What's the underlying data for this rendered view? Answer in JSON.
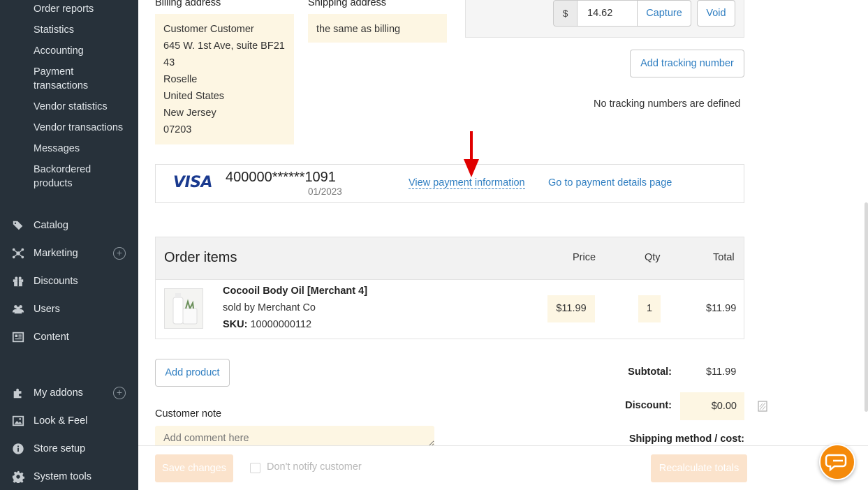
{
  "sidebar": {
    "sub_items": [
      "Order reports",
      "Statistics",
      "Accounting",
      "Payment",
      "transactions",
      "Vendor statistics",
      "Vendor transactions",
      "Messages",
      "Backordered",
      "products"
    ],
    "main_items": [
      {
        "label": "Catalog",
        "icon": "tags-icon"
      },
      {
        "label": "Marketing",
        "icon": "marketing-icon"
      },
      {
        "label": "Discounts",
        "icon": "gift-icon"
      },
      {
        "label": "Users",
        "icon": "users-icon"
      },
      {
        "label": "Content",
        "icon": "content-icon"
      },
      {
        "label": "My addons",
        "icon": "puzzle-icon"
      },
      {
        "label": "Look & Feel",
        "icon": "image-icon"
      },
      {
        "label": "Store setup",
        "icon": "info-icon"
      },
      {
        "label": "System tools",
        "icon": "gear-icon"
      }
    ],
    "plus_symbol": "+"
  },
  "billing": {
    "title": "Billing address",
    "lines": [
      "Customer Customer",
      "645 W. 1st Ave, suite BF21",
      "43",
      "Roselle",
      "United States",
      "New Jersey",
      "07203"
    ]
  },
  "shipping": {
    "title": "Shipping address",
    "value": "the same as billing"
  },
  "capture": {
    "currency": "$",
    "amount": "14.62",
    "capture_label": "Capture",
    "void_label": "Void"
  },
  "tracking": {
    "add_label": "Add tracking number",
    "empty_text": "No tracking numbers are defined"
  },
  "payment": {
    "brand": "VISA",
    "card_number": "400000******1091",
    "expiry": "01/2023",
    "view_info_label": "View payment information",
    "details_label": "Go to payment details page"
  },
  "order_items": {
    "title": "Order items",
    "col_price": "Price",
    "col_qty": "Qty",
    "col_total": "Total",
    "items": [
      {
        "name": "Cocooil Body Oil [Merchant 4]",
        "vendor": "sold by Merchant Co",
        "sku_label": "SKU:",
        "sku": "10000000112",
        "price": "$11.99",
        "qty": "1",
        "total": "$11.99"
      }
    ]
  },
  "add_product_label": "Add product",
  "totals": {
    "subtotal_label": "Subtotal:",
    "subtotal_value": "$11.99",
    "discount_label": "Discount:",
    "discount_value": "$0.00",
    "shipping_label": "Shipping method / cost:"
  },
  "note": {
    "label": "Customer note",
    "placeholder": "Add comment here"
  },
  "bottom_bar": {
    "save_label": "Save changes",
    "dont_notify_label": "Don't notify customer",
    "recalc_label": "Recalculate totals"
  },
  "colors": {
    "sidebar_bg": "#27313a",
    "link": "#2f7ec1",
    "highlight_bg": "#fdf6e3",
    "accent": "#f58a0a",
    "annotation_arrow": "#e00000"
  }
}
